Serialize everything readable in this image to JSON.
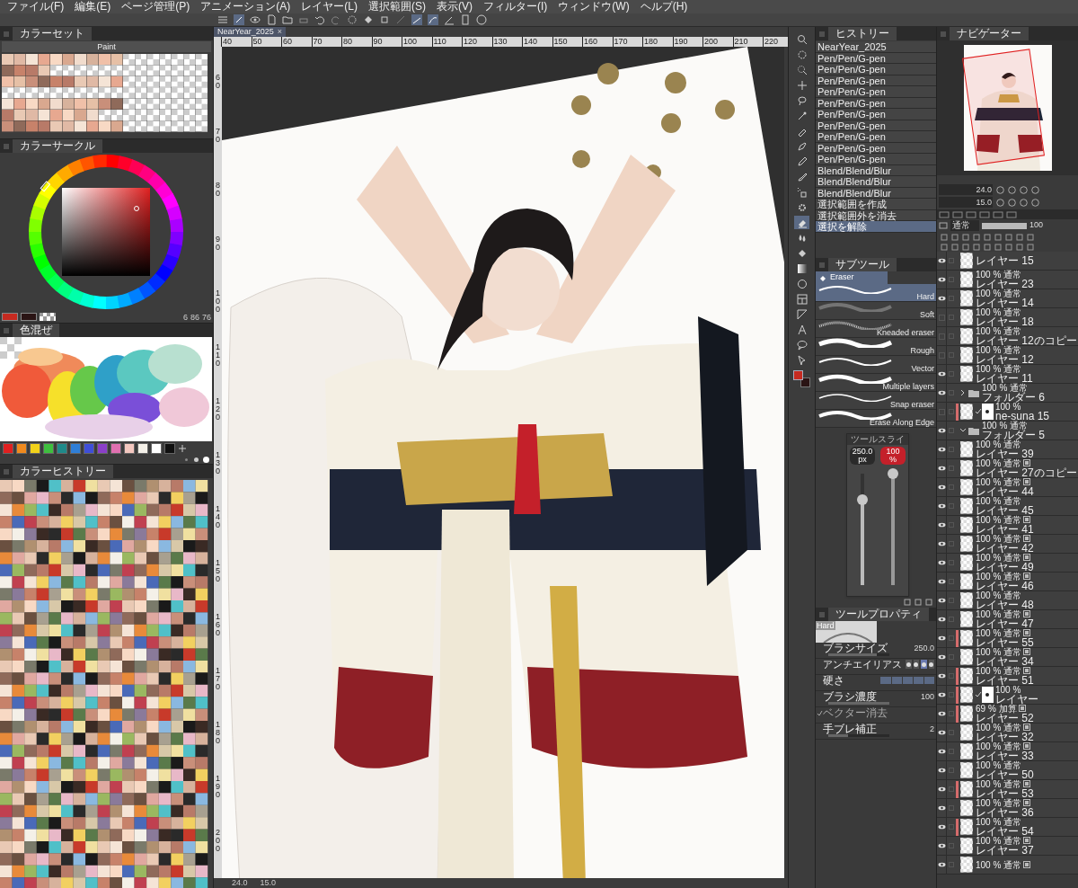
{
  "menu": [
    "ファイル(F)",
    "編集(E)",
    "ページ管理(P)",
    "アニメーション(A)",
    "レイヤー(L)",
    "選択範囲(S)",
    "表示(V)",
    "フィルター(I)",
    "ウィンドウ(W)",
    "ヘルプ(H)"
  ],
  "color_set": {
    "tab": "カラーセット",
    "set_name": "Paint"
  },
  "color_circle": {
    "tab": "カラーサークル",
    "readings": [
      "6",
      "86",
      "76"
    ]
  },
  "color_mixing": {
    "tab": "色混ぜ"
  },
  "quick_colors": [
    {
      "color": "#e02020"
    },
    {
      "color": "#f08a1e"
    },
    {
      "color": "#f2d21a"
    },
    {
      "color": "#3fbf3f"
    },
    {
      "color": "#1f8a8a"
    },
    {
      "color": "#2f7fd8"
    },
    {
      "color": "#3f4fd8"
    },
    {
      "color": "#8a3fc8"
    },
    {
      "color": "#e070b0"
    },
    {
      "color": "#f4c8c0"
    },
    {
      "color": "#f4f0e8"
    },
    {
      "color": "#ffffff"
    },
    {
      "color": "#101010"
    }
  ],
  "color_history": {
    "tab": "カラーヒストリー"
  },
  "document_tab": {
    "title": "NearYear_2025",
    "close": "×"
  },
  "ruler_marks": [
    "40",
    "50",
    "60",
    "70",
    "80",
    "90",
    "100",
    "110",
    "120",
    "130",
    "140",
    "150",
    "160",
    "170",
    "180",
    "190",
    "200",
    "210",
    "220"
  ],
  "vertical_ruler_marks": [
    "60",
    "70",
    "80",
    "90",
    "100",
    "110",
    "120",
    "130",
    "140",
    "150",
    "160",
    "170",
    "180",
    "190",
    "200"
  ],
  "status_bar": {
    "zoom": "24.0",
    "angle": "15.0"
  },
  "tools": [
    {
      "selected": false
    },
    {
      "selected": false
    },
    {
      "selected": false
    },
    {
      "selected": false
    },
    {
      "selected": false
    },
    {
      "selected": false
    },
    {
      "selected": false
    },
    {
      "selected": false
    },
    {
      "selected": false
    },
    {
      "selected": false
    },
    {
      "selected": false
    },
    {
      "selected": false
    },
    {
      "selected": true
    },
    {
      "selected": false
    },
    {
      "selected": false
    },
    {
      "selected": false
    },
    {
      "selected": false
    },
    {
      "selected": false
    },
    {
      "selected": false
    },
    {
      "selected": false
    },
    {
      "selected": false
    },
    {
      "selected": false
    }
  ],
  "draw_colors": [
    {
      "color": "#c62a20"
    },
    {
      "color": "#2a1414"
    }
  ],
  "history": {
    "tab": "ヒストリー",
    "items": [
      {
        "label": "NearYear_2025",
        "selected": false
      },
      {
        "label": "Pen/Pen/G-pen",
        "selected": false
      },
      {
        "label": "Pen/Pen/G-pen",
        "selected": false
      },
      {
        "label": "Pen/Pen/G-pen",
        "selected": false
      },
      {
        "label": "Pen/Pen/G-pen",
        "selected": false
      },
      {
        "label": "Pen/Pen/G-pen",
        "selected": false
      },
      {
        "label": "Pen/Pen/G-pen",
        "selected": false
      },
      {
        "label": "Pen/Pen/G-pen",
        "selected": false
      },
      {
        "label": "Pen/Pen/G-pen",
        "selected": false
      },
      {
        "label": "Pen/Pen/G-pen",
        "selected": false
      },
      {
        "label": "Pen/Pen/G-pen",
        "selected": false
      },
      {
        "label": "Blend/Blend/Blur",
        "selected": false
      },
      {
        "label": "Blend/Blend/Blur",
        "selected": false
      },
      {
        "label": "Blend/Blend/Blur",
        "selected": false
      },
      {
        "label": "選択範囲を作成",
        "selected": false
      },
      {
        "label": "選択範囲外を消去",
        "selected": false
      },
      {
        "label": "選択を解除",
        "selected": true
      }
    ]
  },
  "sub_tool": {
    "tab": "サブツール",
    "group": "Eraser",
    "items": [
      {
        "label": "Hard",
        "selected": true
      },
      {
        "label": "Soft",
        "selected": false
      },
      {
        "label": "Kneaded eraser",
        "selected": false
      },
      {
        "label": "Rough",
        "selected": false
      },
      {
        "label": "Vector",
        "selected": false
      },
      {
        "label": "Multiple layers",
        "selected": false
      },
      {
        "label": "Snap eraser",
        "selected": false
      },
      {
        "label": "Erase Along Edge",
        "selected": false
      }
    ]
  },
  "tool_slider": {
    "title": "ツールスライ",
    "sliders": [
      {
        "reading": "250.0",
        "unit": "px",
        "level": 0.77
      },
      {
        "reading": "100",
        "unit": "%",
        "level": 1
      }
    ]
  },
  "tool_property": {
    "tab": "ツールプロパティ",
    "preview_label": "Hard",
    "rows": [
      {
        "kind": "value",
        "label": "ブラシサイズ",
        "value": "250.0",
        "level": 0.8
      },
      {
        "kind": "options",
        "label": "アンチエイリアス",
        "options": [
          {
            "selected": false
          },
          {
            "selected": false
          },
          {
            "selected": true
          },
          {
            "selected": false
          }
        ]
      },
      {
        "kind": "segments",
        "label": "硬さ",
        "level": 1
      },
      {
        "kind": "value",
        "label": "ブラシ濃度",
        "value": "100",
        "level": 1
      },
      {
        "kind": "check",
        "label": "ベクター消去",
        "checked": true
      },
      {
        "kind": "value",
        "label": "手ブレ補正",
        "value": "2",
        "level": 0.32
      }
    ]
  },
  "navigator": {
    "tab": "ナビゲーター",
    "zoom": "24.0",
    "angle": "15.0"
  },
  "layer_panel": {
    "blend_mode": "通常",
    "opacity": {
      "value": "100",
      "level": 1
    },
    "layers": [
      {
        "kind": "layer",
        "name": "レイヤー 15",
        "visible": true,
        "checked": false
      },
      {
        "kind": "layer",
        "mode": "100 % 通常",
        "name": "レイヤー 23",
        "visible": true,
        "checked": false
      },
      {
        "kind": "layer",
        "mode": "100 % 通常",
        "name": "レイヤー 14",
        "visible": true,
        "checked": false
      },
      {
        "kind": "layer",
        "mode": "100 % 通常",
        "name": "レイヤー 18",
        "visible": false,
        "checked": false
      },
      {
        "kind": "layer",
        "mode": "100 % 通常",
        "name": "レイヤー 12のコピー",
        "visible": false,
        "checked": false
      },
      {
        "kind": "layer",
        "mode": "100 % 通常",
        "name": "レイヤー 12",
        "visible": false,
        "checked": false
      },
      {
        "kind": "layer",
        "mode": "100 % 通常",
        "name": "レイヤー 11",
        "visible": true,
        "checked": false
      },
      {
        "kind": "folder",
        "mode": "100 % 通常",
        "name": "フォルダー 6",
        "visible": true,
        "checked": false,
        "expanded": false
      },
      {
        "kind": "masked",
        "mode": "100 %",
        "name": "ne-suna 15",
        "visible": false,
        "checked": false,
        "color": "#d56b6b"
      },
      {
        "kind": "folder",
        "mode": "100 % 通常",
        "name": "フォルダー 5",
        "visible": true,
        "checked": false,
        "expanded": true,
        "children": [
          {
            "kind": "layer",
            "mode": "100 % 通常",
            "name": "レイヤー 39",
            "visible": true,
            "checked": false
          },
          {
            "kind": "layer",
            "mode": "100 % 通常",
            "name": "レイヤー 27のコピー",
            "visible": true,
            "checked": false,
            "reference": true
          },
          {
            "kind": "layer",
            "mode": "100 % 通常",
            "name": "レイヤー 44",
            "visible": true,
            "checked": false,
            "reference": true
          },
          {
            "kind": "layer",
            "mode": "100 % 通常",
            "name": "レイヤー 45",
            "visible": true,
            "checked": false
          },
          {
            "kind": "layer",
            "mode": "100 % 通常",
            "name": "レイヤー 41",
            "visible": true,
            "checked": false,
            "reference": true
          },
          {
            "kind": "layer",
            "mode": "100 % 通常",
            "name": "レイヤー 42",
            "visible": true,
            "checked": false,
            "reference": true
          },
          {
            "kind": "layer",
            "mode": "100 % 通常",
            "name": "レイヤー 49",
            "visible": true,
            "checked": false,
            "reference": true
          },
          {
            "kind": "layer",
            "mode": "100 % 通常",
            "name": "レイヤー 46",
            "visible": true,
            "checked": false,
            "reference": true
          },
          {
            "kind": "layer",
            "mode": "100 % 通常",
            "name": "レイヤー 48",
            "visible": true,
            "checked": false
          },
          {
            "kind": "layer",
            "mode": "100 % 通常",
            "name": "レイヤー 47",
            "visible": true,
            "checked": false,
            "reference": true
          },
          {
            "kind": "layer",
            "mode": "100 % 通常",
            "name": "レイヤー 55",
            "visible": true,
            "checked": false,
            "reference": true,
            "color": "#d56b6b"
          },
          {
            "kind": "layer",
            "mode": "100 % 通常",
            "name": "レイヤー 34",
            "visible": true,
            "checked": false,
            "reference": true
          },
          {
            "kind": "layer",
            "mode": "100 % 通常",
            "name": "レイヤー 51",
            "visible": true,
            "checked": false,
            "reference": true,
            "color": "#d56b6b"
          },
          {
            "kind": "masked",
            "mode": "100 %",
            "name": "レイヤー",
            "visible": true,
            "checked": false,
            "color": "#d56b6b"
          },
          {
            "kind": "layer",
            "mode": "69 % 加算",
            "name": "レイヤー 52",
            "visible": true,
            "checked": false,
            "reference": true,
            "color": "#d56b6b"
          },
          {
            "kind": "layer",
            "mode": "100 % 通常",
            "name": "レイヤー 32",
            "visible": true,
            "checked": false,
            "reference": true
          },
          {
            "kind": "layer",
            "mode": "100 % 通常",
            "name": "レイヤー 33",
            "visible": true,
            "checked": false,
            "reference": true
          },
          {
            "kind": "layer",
            "mode": "100 % 通常",
            "name": "レイヤー 50",
            "visible": true,
            "checked": false
          },
          {
            "kind": "layer",
            "mode": "100 % 通常",
            "name": "レイヤー 53",
            "visible": true,
            "checked": false,
            "reference": true,
            "color": "#d56b6b"
          },
          {
            "kind": "layer",
            "mode": "100 % 通常",
            "name": "レイヤー 36",
            "visible": true,
            "checked": false,
            "reference": true
          },
          {
            "kind": "layer",
            "mode": "100 % 通常",
            "name": "レイヤー 54",
            "visible": true,
            "checked": false,
            "color": "#d56b6b"
          },
          {
            "kind": "layer",
            "mode": "100 % 通常",
            "name": "レイヤー 37",
            "visible": true,
            "checked": false,
            "reference": true
          },
          {
            "kind": "layer",
            "mode": "100 % 通常",
            "visible": true,
            "checked": false,
            "reference": true
          }
        ]
      }
    ]
  }
}
